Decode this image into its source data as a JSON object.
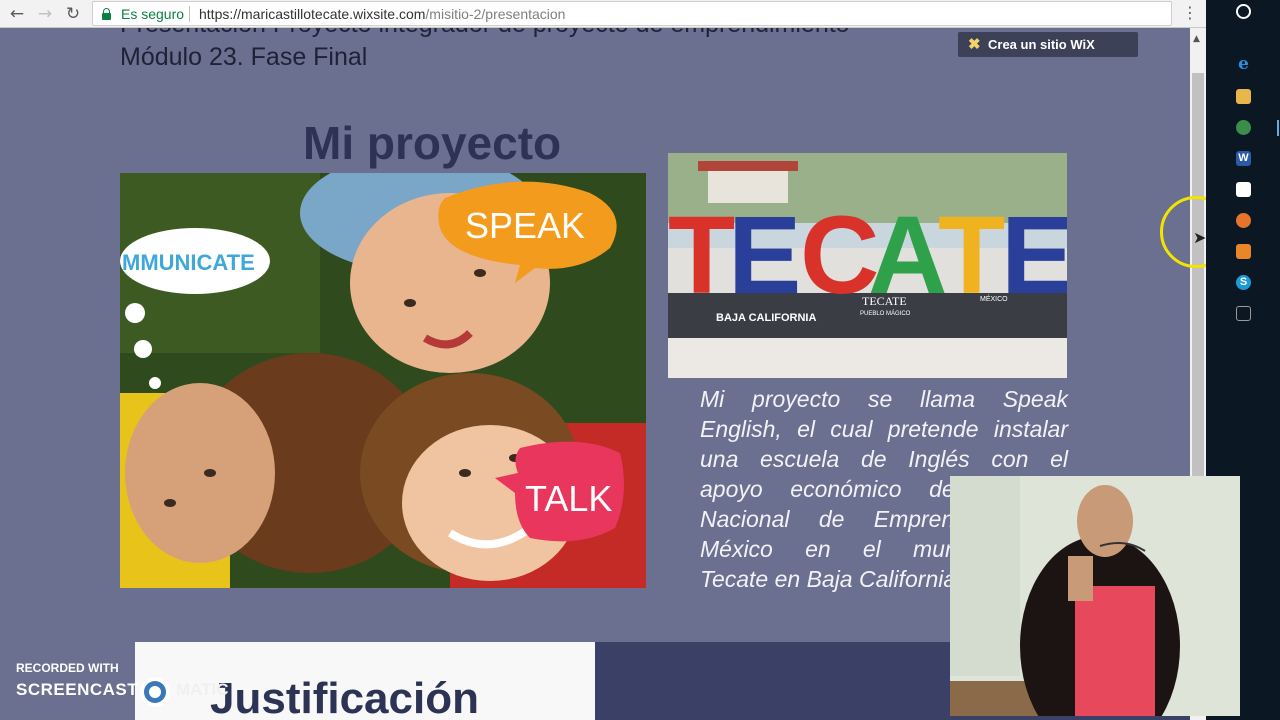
{
  "browser": {
    "secure_label": "Es seguro",
    "url_domain": "https://maricastillotecate.wixsite.com",
    "url_path": "/misitio-2/presentacion",
    "back_icon": "←",
    "forward_icon": "→",
    "reload_icon": "↻",
    "star_icon": "☆",
    "menu_icon": "⋮"
  },
  "page": {
    "cut_heading": "Presentación Proyecto integrador de proyecto de emprendimiento",
    "module_title": "Módulo 23. Fase Final",
    "project_title": "Mi proyecto",
    "kids_image": {
      "bubble_communicate": "MMUNICATE",
      "bubble_speak": "SPEAK",
      "bubble_talk": "TALK"
    },
    "tecate_image": {
      "letters": [
        "T",
        "E",
        "C",
        "A",
        "T",
        "E"
      ],
      "base_baja": "BAJA CALIFORNIA",
      "base_tecate": "TECATE",
      "base_pueblo": "PUEBLO MÁGICO",
      "base_mexico": "MÉXICO"
    },
    "description_lines": [
      "Mi proyecto se llama Speak",
      "English, el cual pretende instalar",
      "una escuela de Inglés con el",
      "apoyo económico del Instituto",
      "Nacional de Emprendedor de",
      "México en el municipio de",
      "Tecate en Baja California."
    ],
    "justification_title": "Justificación",
    "wix_badge": "Crea un sitio WiX"
  },
  "watermark": {
    "recorded_with": "RECORDED WITH",
    "brand_left": "SCREENCAST",
    "brand_right": "MATIC"
  },
  "taskbar": {
    "icons": [
      "cortana-icon",
      "edge-icon",
      "file-explorer-icon",
      "chrome-icon",
      "word-icon",
      "store-icon",
      "firefox-icon",
      "media-player-icon",
      "skype-icon",
      "desktop-icon"
    ]
  },
  "colors": {
    "page_bg": "#6b6f90",
    "title_color": "#2d3354",
    "secure_green": "#0b8043",
    "taskbar_bg": "#0b1824"
  }
}
